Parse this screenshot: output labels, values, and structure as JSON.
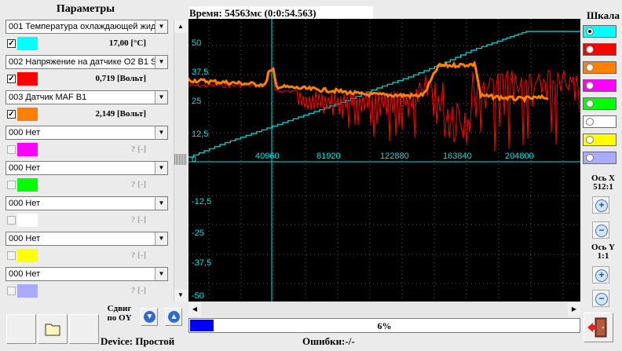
{
  "left_panel": {
    "title": "Параметры",
    "rows": [
      {
        "combo": "001 Температура охлаждающей жид",
        "checked": true,
        "color": "#00ffff",
        "value": "17,00 [°C]"
      },
      {
        "combo": "002 Напряжение на датчике О2 B1 S",
        "checked": true,
        "color": "#ff0000",
        "value": "0,719 [Вольт]"
      },
      {
        "combo": "003 Датчик MAF B1",
        "checked": true,
        "color": "#ff8000",
        "value": "2,149 [Вольт]"
      },
      {
        "combo": "000 Нет",
        "checked": false,
        "color": "#ff00ff",
        "value": "? [-]"
      },
      {
        "combo": "000 Нет",
        "checked": false,
        "color": "#00ff00",
        "value": "? [-]"
      },
      {
        "combo": "000 Нет",
        "checked": false,
        "color": "#ffffff",
        "value": "? [-]"
      },
      {
        "combo": "000 Нет",
        "checked": false,
        "color": "#ffff00",
        "value": "? [-]"
      },
      {
        "combo": "000 Нет",
        "checked": false,
        "color": "#aaaaff",
        "value": "? [-]"
      }
    ]
  },
  "header": {
    "time_label": "Время:",
    "time_value": "54563мс (0:0:54.563)"
  },
  "chart": {
    "upper_y_labels": [
      "50",
      "37,5",
      "25",
      "12,5",
      "0"
    ],
    "x_labels": [
      "40960",
      "81920",
      "122880",
      "163840",
      "204800"
    ],
    "lower_y_labels": [
      "-12,5",
      "-25",
      "-37,5",
      "-50"
    ],
    "colors": {
      "axis": "#00e5e5",
      "temp": "#00e5e5",
      "o2": "#ff0000",
      "maf": "#ff8000",
      "grid": "#ffffff"
    }
  },
  "right_panel": {
    "title": "Шкала",
    "scale_colors": [
      "#00ffff",
      "#ff0000",
      "#ff8000",
      "#ff00ff",
      "#00ff00",
      "#ffffff",
      "#ffff00",
      "#aaaaff"
    ],
    "axis_x_label": "Ось X",
    "axis_x_scale": "512:1",
    "axis_y_label": "Ось Y",
    "axis_y_scale": "1:1"
  },
  "bottom": {
    "shift_label_1": "Сдвиг",
    "shift_label_2": "по OY",
    "progress_percent": 6,
    "progress_text": "6%",
    "device_label": "Device:",
    "device_value": "Простой",
    "errors_label": "Ошибки:",
    "errors_value": "-/-"
  }
}
